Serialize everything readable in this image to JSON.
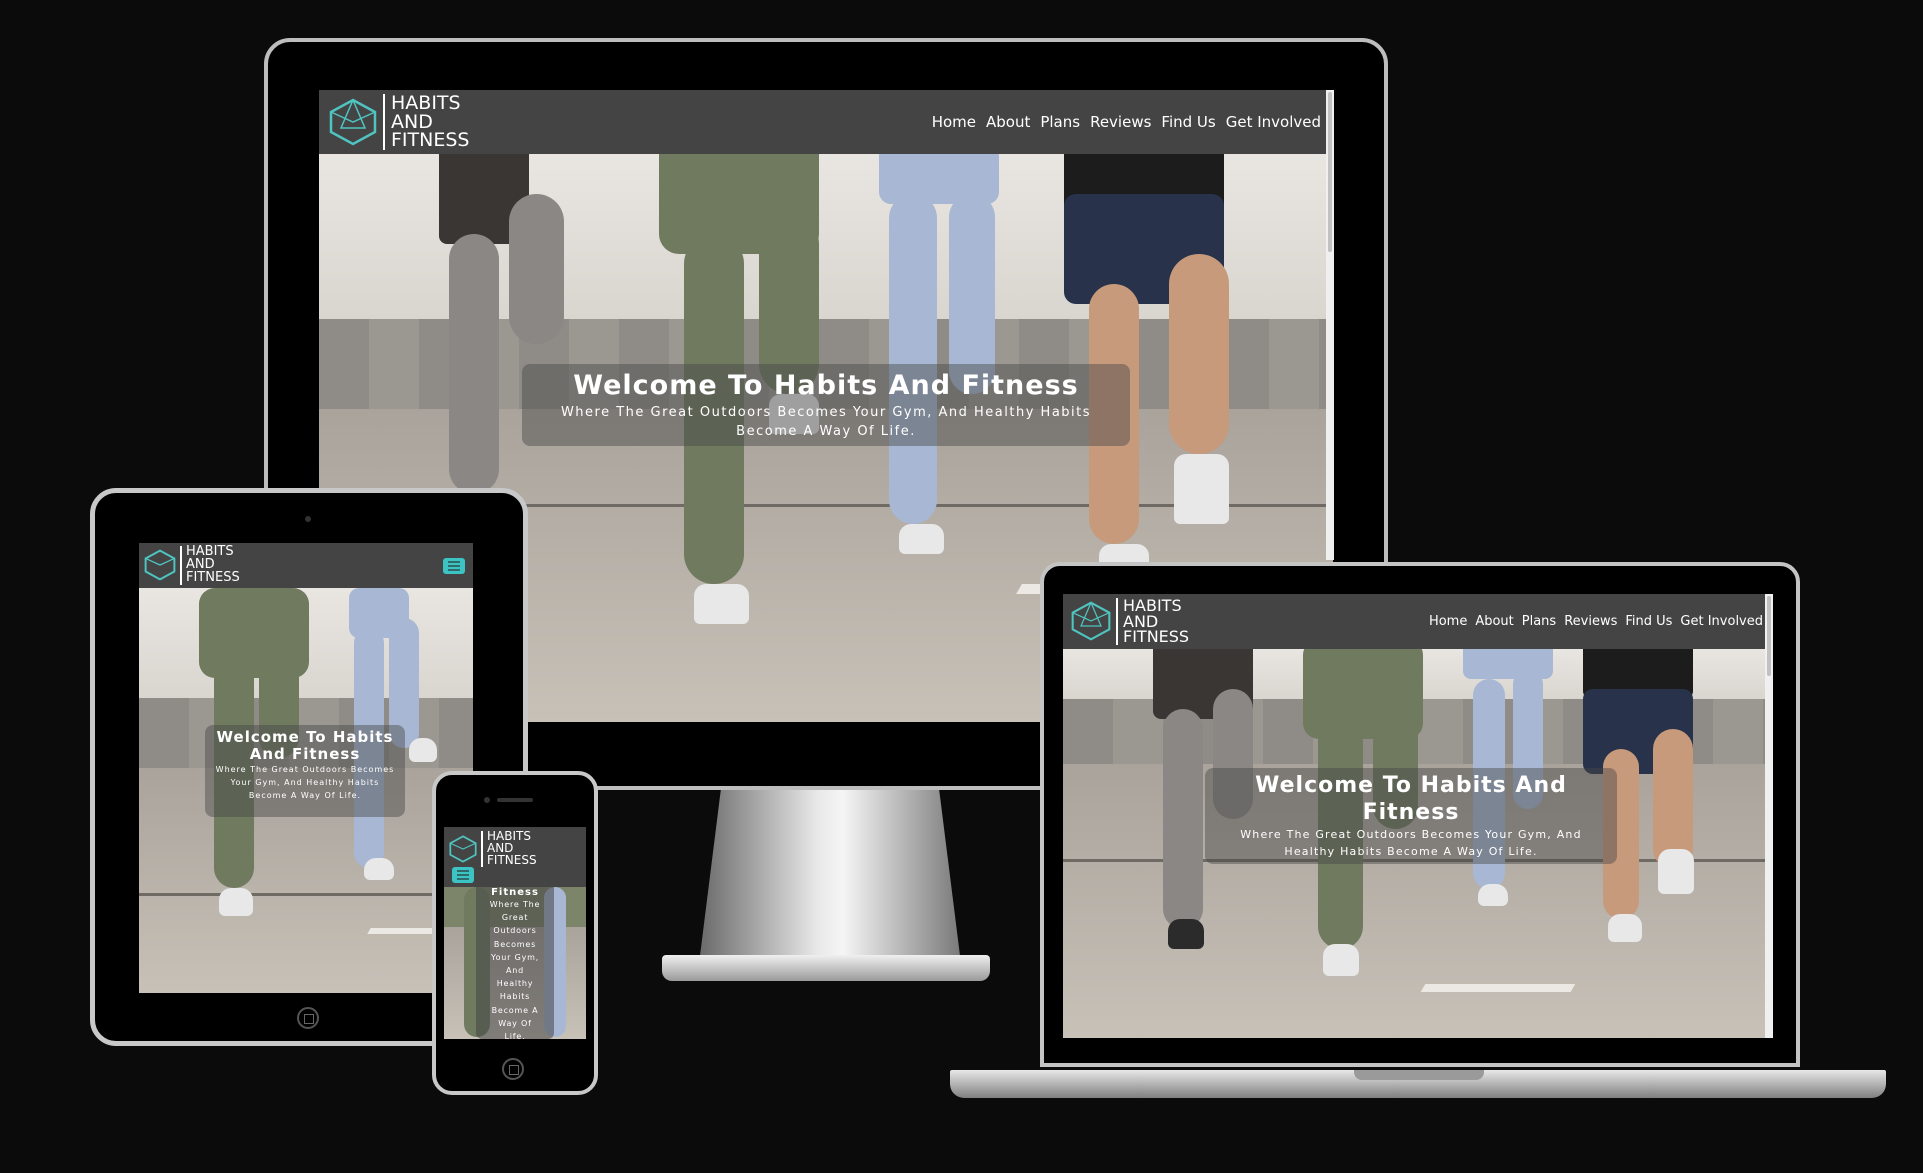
{
  "site": {
    "logo_lines": [
      "HABITS",
      "AND",
      "FITNESS"
    ],
    "nav": [
      "Home",
      "About",
      "Plans",
      "Reviews",
      "Find Us",
      "Get Involved"
    ],
    "hero_title": "Welcome To Habits And Fitness",
    "hero_subtitle": "Where The Great Outdoors Becomes Your Gym, And Healthy Habits Become A Way Of Life.",
    "phone_hero_title_fragment": "Fitness",
    "phone_hero_subtitle_lines": [
      "Where The",
      "Great",
      "Outdoors",
      "Becomes",
      "Your Gym,",
      "And",
      "Healthy",
      "Habits",
      "Become A",
      "Way Of",
      "Life."
    ]
  },
  "colors": {
    "navbar": "#444444",
    "accent": "#3cc3c3",
    "logo_teal": "#4fc4c0",
    "page_background": "#0b0b0b"
  },
  "icons": {
    "logo": "polyhedron-logo-icon",
    "menu": "hamburger-menu-icon",
    "home_button": "home-button-icon"
  }
}
